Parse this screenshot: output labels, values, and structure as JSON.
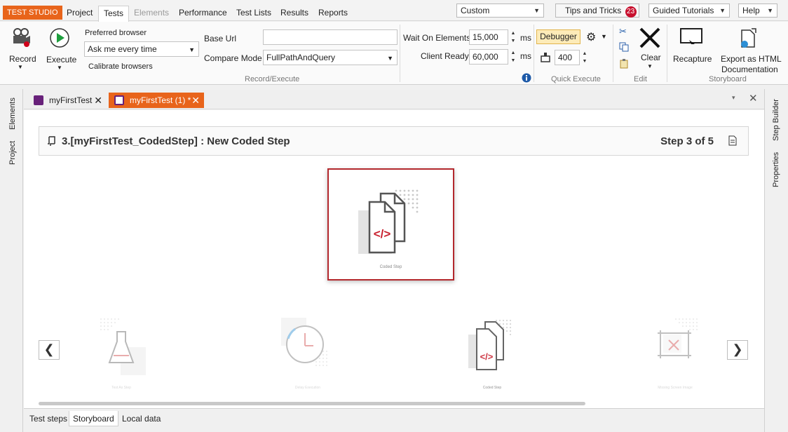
{
  "menubar": {
    "brand": "TEST STUDIO",
    "tabs": [
      {
        "label": "Project",
        "state": "normal"
      },
      {
        "label": "Tests",
        "state": "active"
      },
      {
        "label": "Elements",
        "state": "disabled"
      },
      {
        "label": "Performance",
        "state": "normal"
      },
      {
        "label": "Test Lists",
        "state": "normal"
      },
      {
        "label": "Results",
        "state": "normal"
      },
      {
        "label": "Reports",
        "state": "normal"
      }
    ],
    "layout_select": "Custom",
    "tips": {
      "label": "Tips and Tricks",
      "count": "23"
    },
    "tutorials": "Guided Tutorials",
    "help": "Help"
  },
  "ribbon": {
    "record": "Record",
    "execute": "Execute",
    "preferred_browser_label": "Preferred browser",
    "preferred_browser_value": "Ask me every time",
    "calibrate": "Calibrate browsers",
    "base_url_label": "Base Url",
    "base_url_value": "",
    "compare_mode_label": "Compare Mode",
    "compare_mode_value": "FullPathAndQuery",
    "group_record_execute": "Record/Execute",
    "wait_on_elements_label": "Wait On Elements",
    "wait_on_elements_value": "15,000",
    "client_ready_label": "Client Ready",
    "client_ready_value": "60,000",
    "unit_ms": "ms",
    "debugger": "Debugger",
    "quick_exec_value": "400",
    "group_quick_execute": "Quick Execute",
    "clear": "Clear",
    "group_edit": "Edit",
    "recapture": "Recapture",
    "export_line1": "Export as HTML",
    "export_line2": "Documentation",
    "group_storyboard": "Storyboard"
  },
  "left_panel": {
    "elements": "Elements",
    "project": "Project"
  },
  "right_panel": {
    "step_builder": "Step Builder",
    "properties": "Properties"
  },
  "doc_tabs": [
    {
      "label": "myFirstTest",
      "active": false
    },
    {
      "label": "myFirstTest (1) *",
      "active": true
    }
  ],
  "storyboard": {
    "step_title": "3.[myFirstTest_CodedStep] : New Coded Step",
    "step_count": "Step 3 of 5",
    "featured_caption": "Coded Step",
    "thumbnails": [
      {
        "caption": "Test As Step"
      },
      {
        "caption": "Delay Execution"
      },
      {
        "caption": "Coded Step"
      },
      {
        "caption": "Missing Screen Image"
      }
    ]
  },
  "bottom_tabs": [
    {
      "label": "Test steps",
      "active": false
    },
    {
      "label": "Storyboard",
      "active": true
    },
    {
      "label": "Local data",
      "active": false
    }
  ],
  "colors": {
    "brand": "#e8641b",
    "accent_red": "#b3282d",
    "badge": "#c8102e",
    "debugger_bg": "#fdebb8"
  }
}
